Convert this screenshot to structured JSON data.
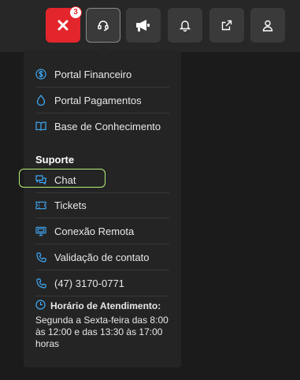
{
  "topbar": {
    "notification_count": "3",
    "buttons": [
      "close-icon",
      "headset-icon",
      "megaphone-icon",
      "bell-icon",
      "external-link-icon",
      "user-icon"
    ]
  },
  "menu": {
    "items": [
      {
        "label": "Portal Financeiro",
        "icon": "dollar-circle-icon"
      },
      {
        "label": "Portal Pagamentos",
        "icon": "drop-icon"
      },
      {
        "label": "Base de Conhecimento",
        "icon": "book-icon"
      }
    ],
    "support_title": "Suporte",
    "support_items": [
      {
        "label": "Chat",
        "icon": "chat-icon"
      },
      {
        "label": "Tickets",
        "icon": "ticket-icon"
      },
      {
        "label": "Conexão Remota",
        "icon": "remote-icon"
      },
      {
        "label": "Validação de contato",
        "icon": "phone-icon"
      },
      {
        "label": "(47) 3170-0771",
        "icon": "phone-icon"
      }
    ],
    "hours": {
      "title": "Horário de Atendimento:",
      "text": "Segunda a Sexta-feira das 8:00 às 12:00 e das 13:30 às 17:00 horas"
    }
  },
  "colors": {
    "accent_blue": "#3fa9f5",
    "red": "#e3262c",
    "chat_highlight": "#b7f07a"
  }
}
